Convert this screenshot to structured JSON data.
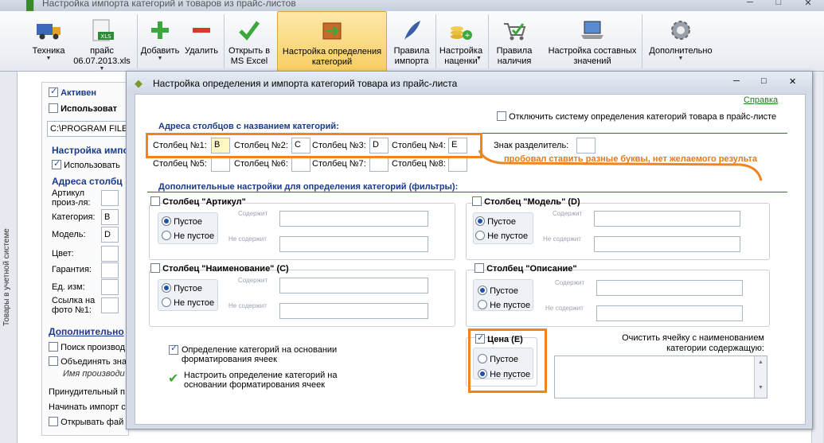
{
  "window": {
    "title": "Настройка импорта категорий и товаров из прайс-листов"
  },
  "toolbar": {
    "items": [
      {
        "label": "Техника",
        "icon": "truck-icon",
        "has_dropdown": true
      },
      {
        "label": "прайс\n06.07.2013.xls",
        "icon": "xls-file-icon",
        "has_dropdown": true
      },
      {
        "label": "Добавить",
        "icon": "plus-icon",
        "has_dropdown": true
      },
      {
        "label": "Удалить",
        "icon": "minus-icon",
        "has_dropdown": false
      },
      {
        "label": "Открыть в\nMS Excel",
        "icon": "checkmark-icon",
        "has_dropdown": false
      },
      {
        "label": "Настройка определения\nкатегорий",
        "icon": "category-settings-icon",
        "has_dropdown": false,
        "selected": true
      },
      {
        "label": "Правила\nимпорта",
        "icon": "quill-icon",
        "has_dropdown": false
      },
      {
        "label": "Настройка\nнаценки",
        "icon": "coins-icon",
        "has_dropdown": true
      },
      {
        "label": "Правила\nналичия",
        "icon": "cart-icon",
        "has_dropdown": false
      },
      {
        "label": "Настройка составных\nзначений",
        "icon": "laptop-icon",
        "has_dropdown": false
      },
      {
        "label": "Дополнительно",
        "icon": "gear-icon",
        "has_dropdown": true
      }
    ]
  },
  "sidebar": {
    "vertical_label": "Товары в учетной системе"
  },
  "background_form": {
    "active_label": "Активен",
    "use_label": "Использоват",
    "path_value": "C:\\PROGRAM FILES",
    "settings_header": "Настройка импо",
    "use_label_2": "Использовать",
    "address_header": "Адреса столбц",
    "fields": [
      {
        "label": "Артикул\nпроиз-ля:",
        "value": ""
      },
      {
        "label": "Категория:",
        "value": "B"
      },
      {
        "label": "Модель:",
        "value": "D"
      },
      {
        "label": "Цвет:",
        "value": ""
      },
      {
        "label": "Гарантия:",
        "value": ""
      },
      {
        "label": "Ед. изм:",
        "value": ""
      },
      {
        "label": "Ссылка на\nфото №1:",
        "value": ""
      }
    ],
    "additional_header": "Дополнительно",
    "search_label": "Поиск производ",
    "merge_label": "Объединять зна",
    "maker_name": "Имя производи",
    "forced_label": "Принудительный п",
    "start_label": "Начинать импорт с",
    "open_label": "Открывать фай"
  },
  "dialog": {
    "title": "Настройка определения и импорта категорий товара из прайс-листа",
    "help_link": "Справка",
    "disable_system_label": "Отключить систему определения категорий товара в прайс-листе",
    "addresses_header": "Адреса столбцов с названием категорий:",
    "columns": [
      {
        "label": "Столбец №1:",
        "value": "B"
      },
      {
        "label": "Столбец №2:",
        "value": "C"
      },
      {
        "label": "Столбец №3:",
        "value": "D"
      },
      {
        "label": "Столбец №4:",
        "value": "E"
      },
      {
        "label": "Столбец №5:",
        "value": ""
      },
      {
        "label": "Столбец №6:",
        "value": ""
      },
      {
        "label": "Столбец №7:",
        "value": ""
      },
      {
        "label": "Столбец №8:",
        "value": ""
      }
    ],
    "separator_label": "Знак разделитель:",
    "separator_value": "",
    "annotation": "пробовал ставить разные буквы, нет желаемого результа",
    "filters_header": "Дополнительные настройки для определения категорий (фильтры):",
    "radio_empty": "Пустое",
    "radio_not_empty": "Не пустое",
    "contains_label": "Содержит",
    "not_contains_label": "Не содержит",
    "groups": {
      "article": {
        "title": "Столбец \"Артикул\"",
        "checked": false,
        "empty_selected": true
      },
      "model": {
        "title": "Столбец \"Модель\" (D)",
        "checked": false,
        "empty_selected": true
      },
      "name": {
        "title": "Столбец \"Наименование\" (C)",
        "checked": false,
        "empty_selected": true
      },
      "description": {
        "title": "Столбец \"Описание\"",
        "checked": false,
        "empty_selected": true
      },
      "price": {
        "title": "Цена (E)",
        "checked": true,
        "empty_selected": false
      }
    },
    "format_detect_label": "Определение категорий на основании\nформатирования ячеек",
    "format_settings_link": "Настроить определение категорий на\nосновании форматирования ячеек",
    "clear_cell_label": "Очистить ячейку с наименованием\nкатегории содержащую:"
  },
  "colors": {
    "highlight_orange": "#f28420",
    "header_blue": "#1a3a8a",
    "link_green": "#1f7a2a"
  }
}
